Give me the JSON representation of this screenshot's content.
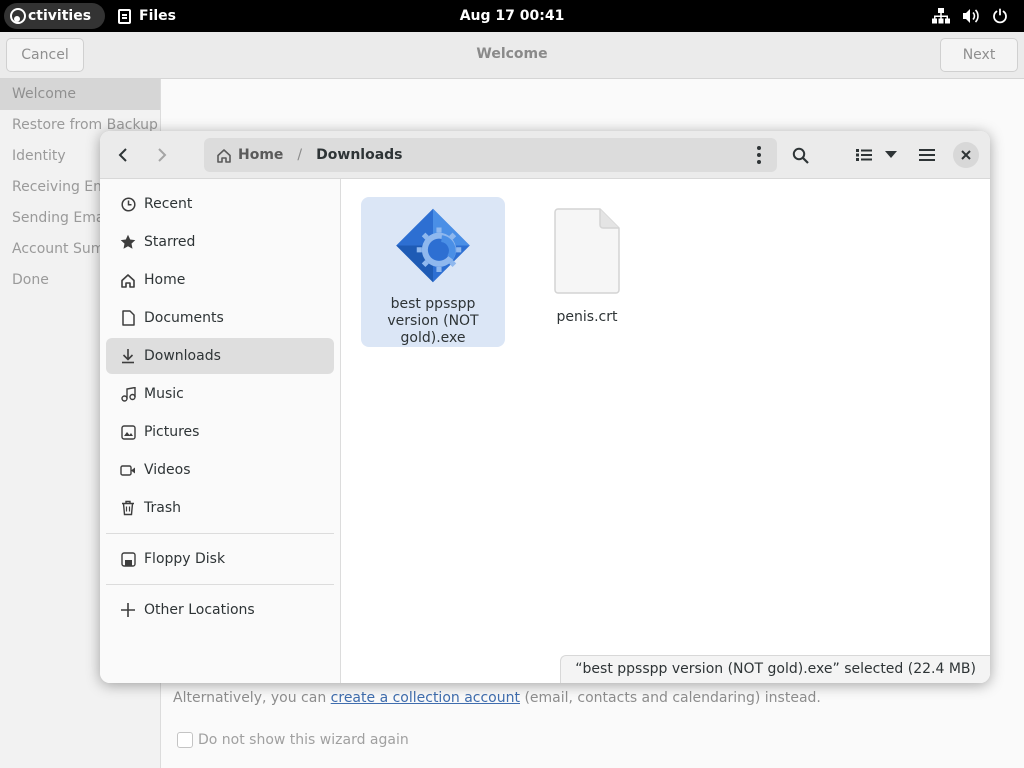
{
  "topbar": {
    "activities_label": "ctivities",
    "app_name": "Files",
    "clock": "Aug 17  00:41"
  },
  "wizard": {
    "cancel_label": "Cancel",
    "next_label": "Next",
    "title": "Welcome",
    "steps": [
      "Welcome",
      "Restore from Backup",
      "Identity",
      "Receiving Em",
      "Sending Emai",
      "Account Summ",
      "Done"
    ],
    "alt_prefix": "Alternatively, you can ",
    "alt_link": "create a collection account",
    "alt_suffix": " (email, contacts and calendaring) instead.",
    "checkbox_label": "Do not show this wizard again"
  },
  "dialog": {
    "path": [
      "Home",
      "Downloads"
    ],
    "places": [
      {
        "label": "Recent",
        "icon": "clock-icon"
      },
      {
        "label": "Starred",
        "icon": "star-icon"
      },
      {
        "label": "Home",
        "icon": "home-icon"
      },
      {
        "label": "Documents",
        "icon": "document-icon"
      },
      {
        "label": "Downloads",
        "icon": "download-icon"
      },
      {
        "label": "Music",
        "icon": "music-icon"
      },
      {
        "label": "Pictures",
        "icon": "picture-icon"
      },
      {
        "label": "Videos",
        "icon": "video-icon"
      },
      {
        "label": "Trash",
        "icon": "trash-icon"
      }
    ],
    "devices": [
      {
        "label": "Floppy Disk",
        "icon": "floppy-icon"
      }
    ],
    "other_locations": "Other Locations",
    "files": [
      {
        "name": "best ppsspp version (NOT gold).exe",
        "icon": "executable-icon",
        "selected": true
      },
      {
        "name": "penis.crt",
        "icon": "generic-file-icon",
        "selected": false
      }
    ],
    "status": "“best ppsspp version (NOT gold).exe” selected  (22.4 MB)",
    "colors": {
      "selection": "#dbe6f6",
      "accent": "#3584e4"
    }
  }
}
